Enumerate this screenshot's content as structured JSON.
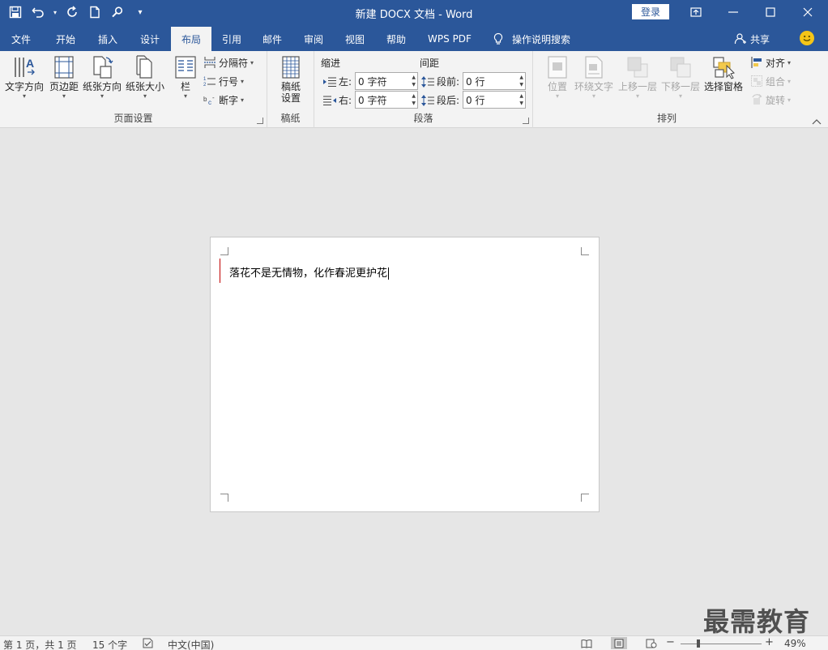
{
  "titlebar": {
    "title": "新建 DOCX 文档  -  Word",
    "login_label": "登录"
  },
  "tabs": [
    {
      "label": "文件"
    },
    {
      "label": "开始"
    },
    {
      "label": "插入"
    },
    {
      "label": "设计"
    },
    {
      "label": "布局",
      "active": true
    },
    {
      "label": "引用"
    },
    {
      "label": "邮件"
    },
    {
      "label": "审阅"
    },
    {
      "label": "视图"
    },
    {
      "label": "帮助"
    },
    {
      "label": "WPS PDF"
    }
  ],
  "tell_me": {
    "label": "操作说明搜索",
    "icon": "lightbulb-icon"
  },
  "share": {
    "label": "共享",
    "icon": "person-icon"
  },
  "ribbon": {
    "page_setup": {
      "label": "页面设置",
      "text_direction": "文字方向",
      "margins": "页边距",
      "orientation": "纸张方向",
      "size": "纸张大小",
      "columns": "栏",
      "breaks": "分隔符",
      "line_numbers": "行号",
      "hyphenation": "断字"
    },
    "manuscript": {
      "label": "稿纸",
      "setup_line1": "稿纸",
      "setup_line2": "设置"
    },
    "paragraph": {
      "label": "段落",
      "indent_label": "缩进",
      "spacing_label": "间距",
      "indent_left_label": "左:",
      "indent_left_value": "0 字符",
      "indent_right_label": "右:",
      "indent_right_value": "0 字符",
      "space_before_label": "段前:",
      "space_before_value": "0 行",
      "space_after_label": "段后:",
      "space_after_value": "0 行"
    },
    "arrange": {
      "label": "排列",
      "position": "位置",
      "wrap_text": "环绕文字",
      "bring_forward": "上移一层",
      "send_backward": "下移一层",
      "selection_pane": "选择窗格",
      "align": "对齐",
      "group": "组合",
      "rotate": "旋转"
    }
  },
  "document": {
    "text": "落花不是无情物，化作春泥更护花"
  },
  "statusbar": {
    "page": "第 1 页，共 1 页",
    "words": "15 个字",
    "language": "中文(中国)",
    "zoom": "49%",
    "zoom_level": 0.49
  },
  "watermark": "最需教育",
  "colors": {
    "brand": "#2b579a",
    "ribbon_bg": "#f3f3f3",
    "canvas_bg": "#e6e6e6"
  }
}
